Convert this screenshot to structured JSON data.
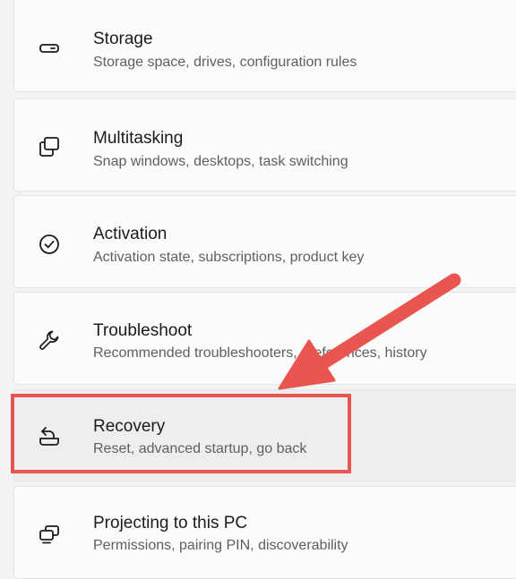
{
  "items": [
    {
      "title": "Storage",
      "subtitle": "Storage space, drives, configuration rules",
      "icon": "storage-icon"
    },
    {
      "title": "Multitasking",
      "subtitle": "Snap windows, desktops, task switching",
      "icon": "multitasking-icon"
    },
    {
      "title": "Activation",
      "subtitle": "Activation state, subscriptions, product key",
      "icon": "activation-icon"
    },
    {
      "title": "Troubleshoot",
      "subtitle": "Recommended troubleshooters, preferences, history",
      "icon": "wrench-icon"
    },
    {
      "title": "Recovery",
      "subtitle": "Reset, advanced startup, go back",
      "icon": "recovery-icon"
    },
    {
      "title": "Projecting to this PC",
      "subtitle": "Permissions, pairing PIN, discoverability",
      "icon": "projecting-icon"
    }
  ],
  "annotation": {
    "highlight_color": "#e8564f",
    "highlighted_item": "Recovery"
  }
}
